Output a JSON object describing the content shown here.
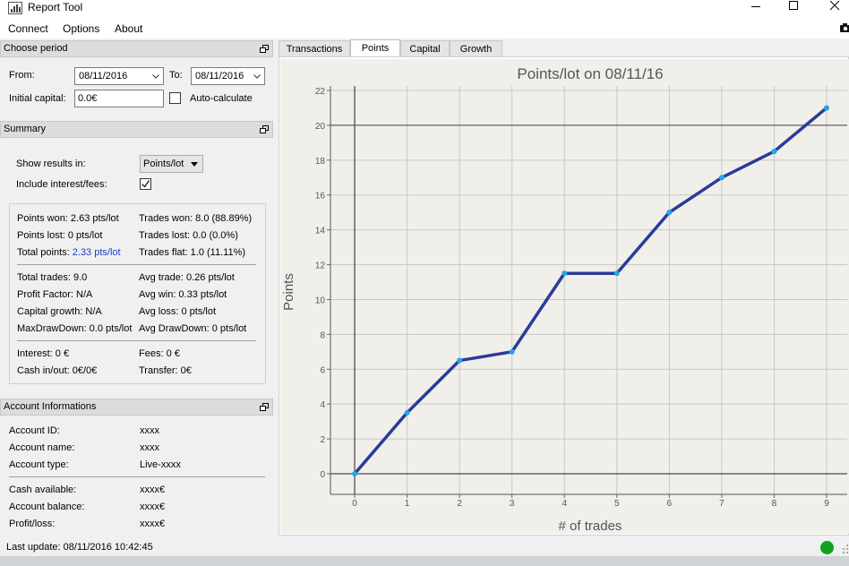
{
  "window": {
    "title": "Report Tool",
    "controls": [
      "minimize",
      "maximize",
      "close"
    ]
  },
  "menu": {
    "items": [
      "Connect",
      "Options",
      "About"
    ]
  },
  "choose_period": {
    "header": "Choose period",
    "from_label": "From:",
    "from_value": "08/11/2016",
    "to_label": "To:",
    "to_value": "08/11/2016",
    "initial_capital_label": "Initial capital:",
    "initial_capital_value": "0.0€",
    "auto_calculate_label": "Auto-calculate",
    "auto_calculate_checked": false
  },
  "summary": {
    "header": "Summary",
    "show_results_label": "Show results in:",
    "show_results_value": "Points/lot",
    "include_interest_label": "Include interest/fees:",
    "include_interest_checked": true,
    "left_col_1": [
      "Points won: 2.63 pts/lot",
      "Points lost: 0 pts/lot"
    ],
    "total_points_label": "Total points: ",
    "total_points_value": "2.33 pts/lot",
    "right_col_1": [
      "Trades won: 8.0 (88.89%)",
      "Trades lost: 0.0 (0.0%)",
      "Trades flat: 1.0 (11.11%)"
    ],
    "left_col_2": [
      "Total trades: 9.0",
      "Profit Factor: N/A",
      "Capital growth: N/A",
      "MaxDrawDown: 0.0 pts/lot"
    ],
    "right_col_2": [
      "Avg trade: 0.26 pts/lot",
      "Avg win: 0.33 pts/lot",
      "Avg loss: 0 pts/lot",
      "Avg DrawDown: 0 pts/lot"
    ],
    "left_col_3": [
      "Interest: 0 €",
      "Cash in/out: 0€/0€"
    ],
    "right_col_3": [
      "Fees: 0 €",
      "Transfer: 0€"
    ]
  },
  "account": {
    "header": "Account Informations",
    "rows_1": [
      {
        "label": "Account ID:",
        "value": "xxxx"
      },
      {
        "label": "Account name:",
        "value": "xxxx"
      },
      {
        "label": "Account type:",
        "value": "Live-xxxx"
      }
    ],
    "rows_2": [
      {
        "label": "Cash available:",
        "value": "xxxx€"
      },
      {
        "label": "Account balance:",
        "value": "xxxx€"
      },
      {
        "label": "Profit/loss:",
        "value": "xxxx€"
      }
    ]
  },
  "status": {
    "last_update": "Last update: 08/11/2016 10:42:45",
    "connection_color": "#11a31b"
  },
  "tabs": [
    "Transactions",
    "Points",
    "Capital",
    "Growth"
  ],
  "active_tab": "Points",
  "chart_data": {
    "type": "line",
    "title": "Points/lot on 08/11/16",
    "xlabel": "# of trades",
    "ylabel": "Points",
    "x": [
      0,
      1,
      2,
      3,
      4,
      5,
      6,
      7,
      8,
      9
    ],
    "y": [
      0,
      3.5,
      6.5,
      7,
      11.5,
      11.5,
      15,
      17,
      18.5,
      21
    ],
    "xlim": [
      0,
      9
    ],
    "ylim": [
      0,
      22
    ],
    "x_ticks": [
      "0",
      "1",
      "2",
      "3",
      "4",
      "5",
      "6",
      "7",
      "8",
      "9"
    ],
    "y_ticks": [
      "0",
      "2",
      "4",
      "6",
      "8",
      "10",
      "12",
      "14",
      "16",
      "18",
      "20",
      "22"
    ],
    "grid": true,
    "line_color": "#2b3a9a",
    "point_color": "#1ea8f0"
  }
}
